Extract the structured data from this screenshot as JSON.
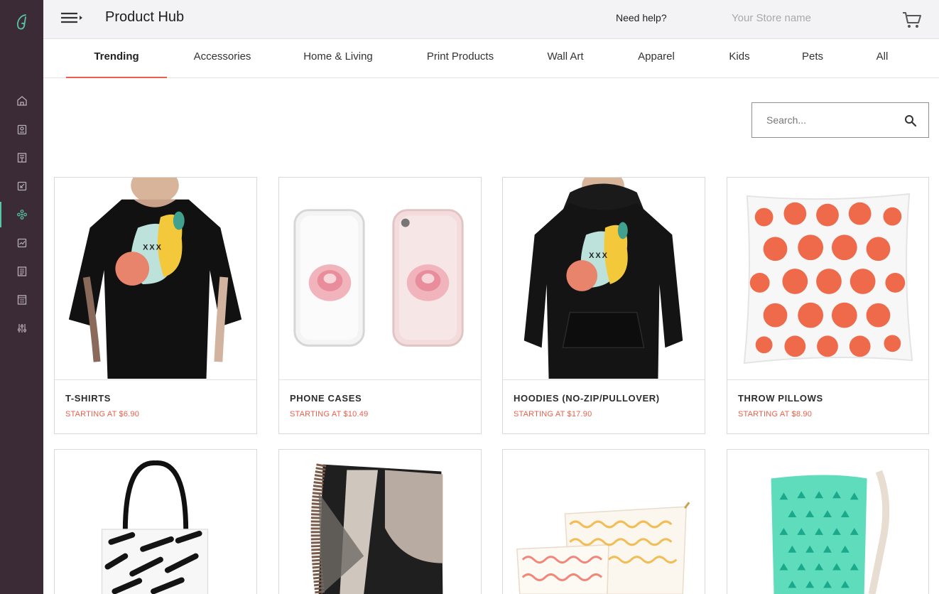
{
  "header": {
    "title": "Product Hub",
    "help_label": "Need help?",
    "store_name": "Your Store name"
  },
  "sidebar": {
    "items": [
      {
        "icon": "home-icon"
      },
      {
        "icon": "orders-icon"
      },
      {
        "icon": "document-icon"
      },
      {
        "icon": "import-icon"
      },
      {
        "icon": "product-hub-icon",
        "active": true
      },
      {
        "icon": "analytics-icon"
      },
      {
        "icon": "catalog-icon"
      },
      {
        "icon": "billing-icon"
      },
      {
        "icon": "settings-sliders-icon"
      }
    ]
  },
  "tabs": [
    {
      "label": "Trending",
      "active": true
    },
    {
      "label": "Accessories"
    },
    {
      "label": "Home & Living"
    },
    {
      "label": "Print Products"
    },
    {
      "label": "Wall Art"
    },
    {
      "label": "Apparel"
    },
    {
      "label": "Kids"
    },
    {
      "label": "Pets"
    },
    {
      "label": "All"
    }
  ],
  "search": {
    "placeholder": "Search..."
  },
  "products": [
    {
      "name": "T-SHIRTS",
      "price": "STARTING AT $6.90"
    },
    {
      "name": "PHONE CASES",
      "price": "STARTING AT $10.49"
    },
    {
      "name": "HOODIES (NO-ZIP/PULLOVER)",
      "price": "STARTING AT $17.90"
    },
    {
      "name": "THROW PILLOWS",
      "price": "STARTING AT $8.90"
    },
    {
      "name": "",
      "price": ""
    },
    {
      "name": "",
      "price": ""
    },
    {
      "name": "",
      "price": ""
    },
    {
      "name": "",
      "price": ""
    }
  ],
  "colors": {
    "sidebar": "#3a2b37",
    "accent": "#e8604c",
    "active_indicator": "#58c4a9"
  }
}
